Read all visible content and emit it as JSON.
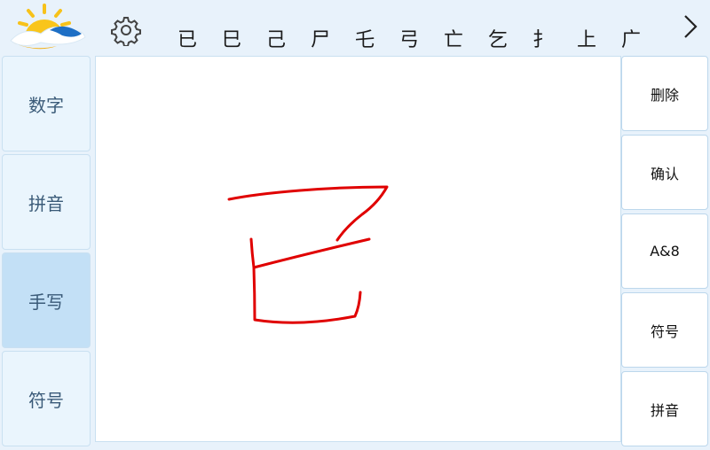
{
  "toolbar": {
    "candidates": [
      "已",
      "巳",
      "己",
      "尸",
      "乇",
      "弓",
      "亡",
      "乞",
      "扌",
      "上",
      "广"
    ]
  },
  "modes": [
    {
      "label": "数字",
      "name": "mode-number",
      "active": false
    },
    {
      "label": "拼音",
      "name": "mode-pinyin",
      "active": false
    },
    {
      "label": "手写",
      "name": "mode-handwriting",
      "active": true
    },
    {
      "label": "符号",
      "name": "mode-symbol",
      "active": false
    }
  ],
  "actions": [
    {
      "label": "删除",
      "name": "delete-button"
    },
    {
      "label": "确认",
      "name": "confirm-button"
    },
    {
      "label": "A&8",
      "name": "alphanumeric-button"
    },
    {
      "label": "符号",
      "name": "symbol-button"
    },
    {
      "label": "拼音",
      "name": "pinyin-button"
    }
  ],
  "ink": {
    "color": "#e00000"
  },
  "icons": {
    "logo": "weather-logo-icon",
    "settings": "gear-icon",
    "next": "chevron-right-icon"
  }
}
